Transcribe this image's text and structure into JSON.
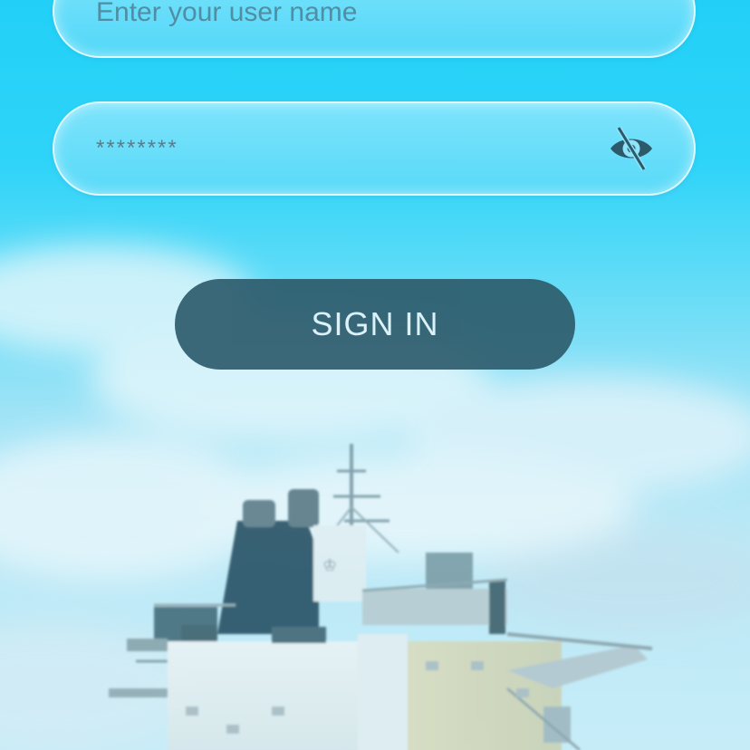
{
  "login_form": {
    "username_placeholder": "Enter your user name",
    "password_value": "********",
    "password_visibility_icon": "eye-off-icon",
    "sign_in_label": "SIGN IN"
  },
  "background": {
    "image_subject": "ship superstructure under sky"
  },
  "colors": {
    "sky_top": "#22d0f7",
    "sky_bottom": "#c6ecf8",
    "field_fill": "#8fe4fa",
    "field_border": "#ebfcff",
    "field_text": "#4f8ea3",
    "button_fill": "#2e5c6d",
    "button_text": "#dff3f8"
  }
}
